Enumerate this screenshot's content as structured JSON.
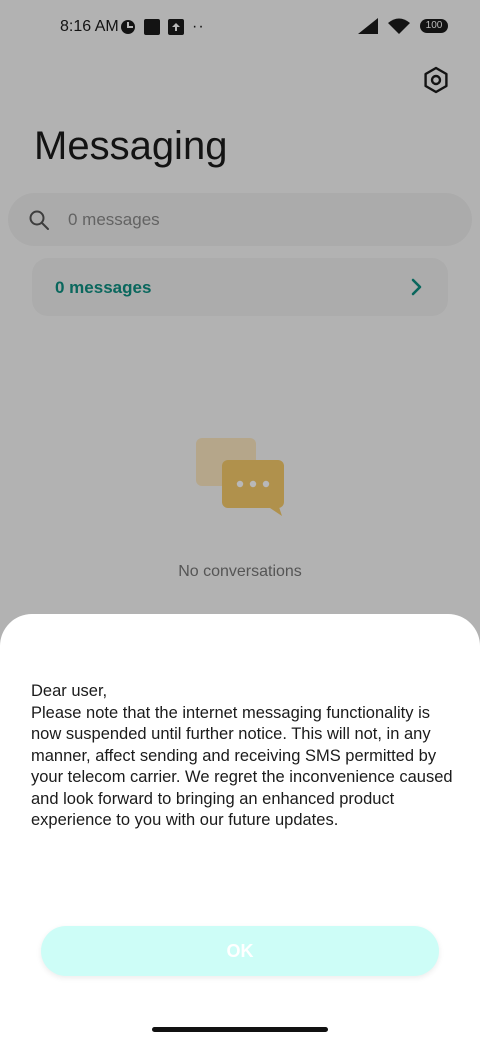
{
  "status_bar": {
    "time": "8:16 AM",
    "more_indicator": "··",
    "battery": "100"
  },
  "header": {
    "title": "Messaging",
    "settings_icon": "settings-icon"
  },
  "search": {
    "placeholder": "0 messages"
  },
  "messages_card": {
    "label": "0 messages"
  },
  "empty_state": {
    "text": "No conversations",
    "icon": "chat-bubbles-icon"
  },
  "dialog": {
    "body": "Dear user,\nPlease note that the internet messaging functionality is now suspended until further notice. This will not, in any manner, affect sending and receiving SMS permitted by your telecom carrier. We regret the inconvenience caused and look forward to bringing an enhanced product experience to you with our future updates.",
    "ok_label": "OK"
  },
  "colors": {
    "accent": "#0e8f82",
    "ok_button_bg": "#cdfdf7",
    "illustration": "#f4c96a"
  }
}
